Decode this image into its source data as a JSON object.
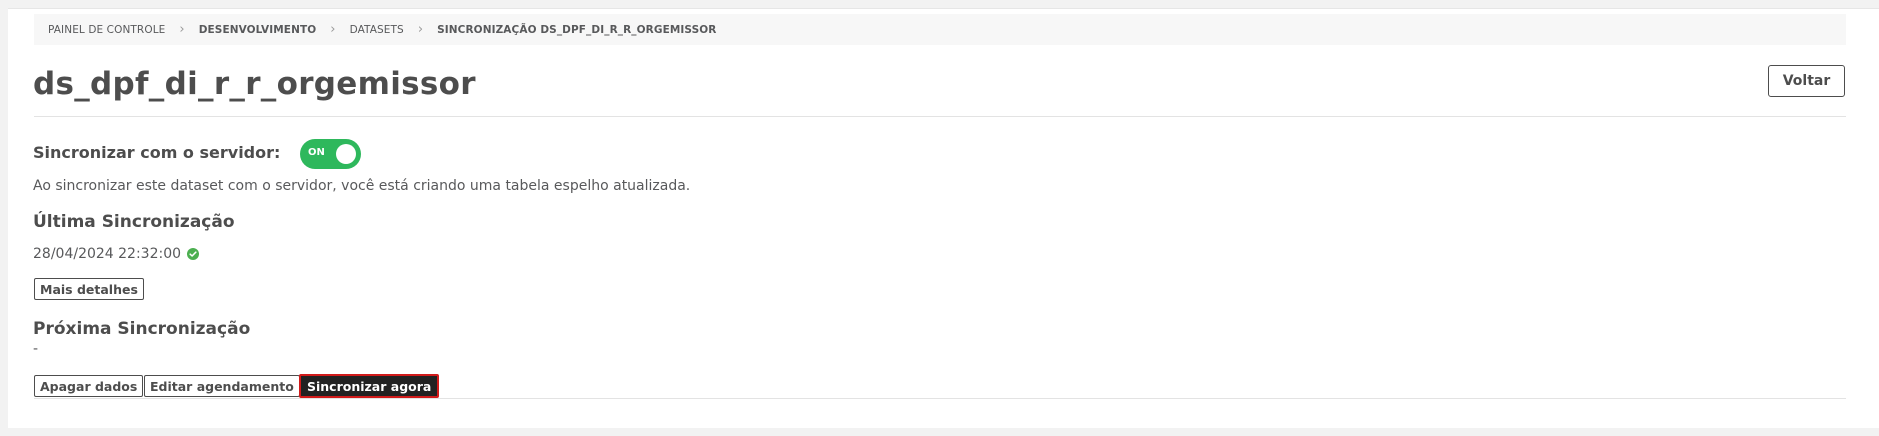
{
  "breadcrumb": {
    "items": [
      {
        "label": "PAINEL DE CONTROLE"
      },
      {
        "label": "DESENVOLVIMENTO"
      },
      {
        "label": "DATASETS"
      },
      {
        "label": "SINCRONIZAÇÃO DS_DPF_DI_R_R_ORGEMISSOR"
      }
    ]
  },
  "header": {
    "title": "ds_dpf_di_r_r_orgemissor",
    "back_label": "Voltar"
  },
  "sync": {
    "label": "Sincronizar com o servidor:",
    "toggle_text": "ON",
    "toggle_state": "on",
    "toggle_color": "#2eb85c",
    "description": "Ao sincronizar este dataset com o servidor, você está criando uma tabela espelho atualizada."
  },
  "last_sync": {
    "heading": "Última Sincronização",
    "value": "28/04/2024 22:32:00",
    "status_icon": "check-circle-icon",
    "status_color": "#4caf50",
    "details_label": "Mais detalhes"
  },
  "next_sync": {
    "heading": "Próxima Sincronização",
    "value": "-"
  },
  "actions": {
    "delete_label": "Apagar dados",
    "edit_schedule_label": "Editar agendamento",
    "sync_now_label": "Sincronizar agora"
  }
}
